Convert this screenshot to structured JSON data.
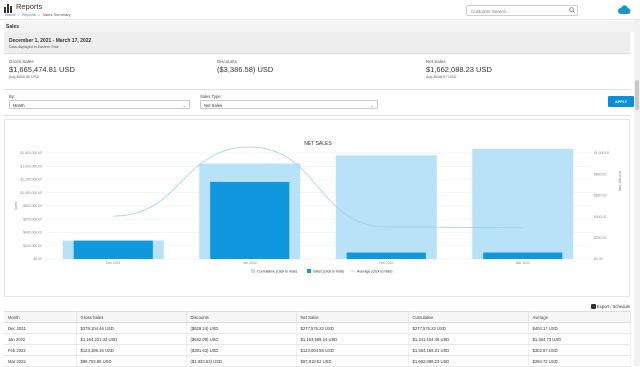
{
  "app": {
    "title": "Reports"
  },
  "breadcrumb": [
    "Home",
    "Reports",
    "Sales Summary"
  ],
  "search": {
    "placeholder": "Customer Search..."
  },
  "page": {
    "title": "Sales",
    "date_range": "December 1, 2021 - March 17, 2022",
    "timezone": "Data displayed in Eastern Time"
  },
  "kpis": [
    {
      "label": "Gross Sales",
      "value": "$1,665,474.81 USD",
      "avg": "Avg $800.80 USD"
    },
    {
      "label": "Discounts",
      "value": "($3,386.58) USD",
      "avg": ""
    },
    {
      "label": "Net Sales",
      "value": "$1,662,088.23 USD",
      "avg": "Avg $848.97 USD"
    }
  ],
  "filters": {
    "by_label": "By:",
    "by_value": "Month",
    "sales_type_label": "Sales Type:",
    "sales_type_value": "Net Sales",
    "apply_label": "APPLY"
  },
  "chart_data": {
    "type": "bar",
    "title": "NET SALES",
    "categories": [
      "Dec 2021",
      "Jan 2022",
      "Feb 2022",
      "Mar 2022"
    ],
    "left_axis": {
      "ticks": [
        "$0.00",
        "$200,000.00",
        "$400,000.00",
        "$600,000.00",
        "$800,000.00",
        "$1,000,000.00",
        "$1,200,000.00",
        "$1,400,000.00",
        "$1,600,000.00"
      ],
      "label": "Sales",
      "ylim": [
        0,
        1600000
      ]
    },
    "right_axis": {
      "ticks": [
        "$0.00",
        "$200.00",
        "$400.00",
        "$600.00",
        "$800.00",
        "$1,000.00"
      ],
      "label": "Average Sale",
      "ylim": [
        0,
        1000
      ]
    },
    "series": [
      {
        "name": "Cumulative (click to hide)",
        "color": "#b8e2f8",
        "values": [
          277575.22,
          1441164.46,
          1564169.01,
          1662088.23
        ]
      },
      {
        "name": "Sales (click to hide)",
        "color": "#0f98de",
        "values": [
          277575.22,
          1163589.24,
          97304.55,
          97919.52
        ]
      },
      {
        "name": "Average (click to hide)",
        "color": "#c9e6f5",
        "values": [
          404.17,
          1364.73,
          302.87,
          294.72
        ]
      }
    ]
  },
  "export": {
    "label": "Export / Schedule"
  },
  "table": {
    "columns": [
      "Month",
      "Gross Sales",
      "Discounts",
      "Net Sales",
      "Cumulative",
      "Average"
    ],
    "rows": [
      [
        "Dec 2021",
        "$278,104.46 USD",
        "($529.24) USD",
        "$277,575.22 USD",
        "$277,575.22 USD",
        "$404.17 USD"
      ],
      [
        "Jan 2022",
        "$1,164,221.32 USD",
        "($632.08) USD",
        "$1,163,589.24 USD",
        "$1,441,164.46 USD",
        "$1,364.73 USD"
      ],
      [
        "Feb 2022",
        "$123,396.16 USD",
        "($391.63) USD",
        "$123,004.55 USD",
        "$1,564,169.01 USD",
        "$302.87 USD"
      ],
      [
        "Mar 2022",
        "$99,753.85 USD",
        "($1,833.63) USD",
        "$97,919.52 USD",
        "$1,662,088.23 USD",
        "$294.72 USD"
      ]
    ]
  }
}
